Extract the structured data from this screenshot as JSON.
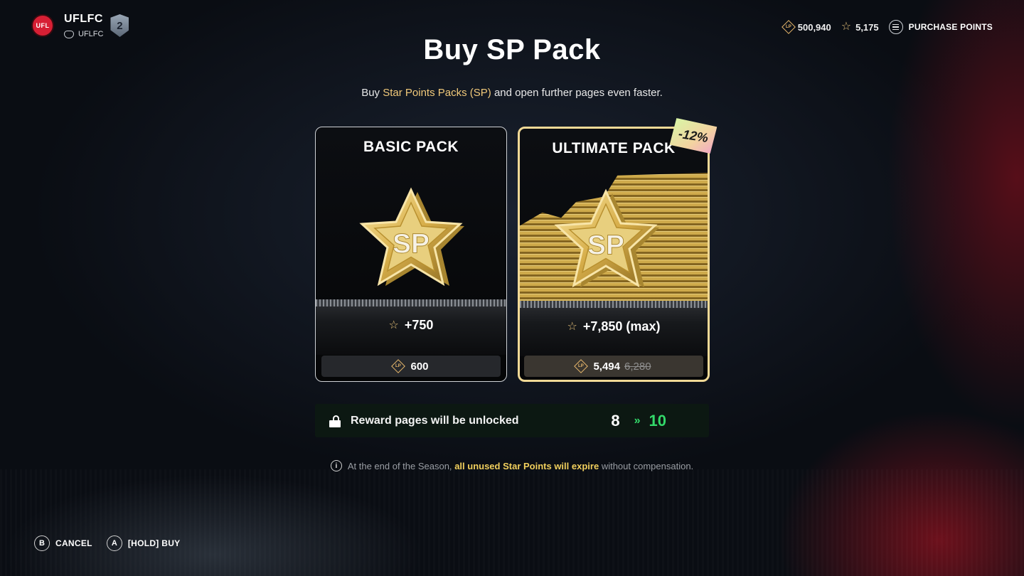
{
  "profile": {
    "logo_text": "UFL",
    "club_name": "UFLFC",
    "sub_name": "UFLFC",
    "level": "2"
  },
  "header": {
    "ufl_points": "500,940",
    "star_points": "5,175",
    "purchase_label": "PURCHASE POINTS",
    "ufl_icon_text": "LP",
    "sp_icon_text": "SP"
  },
  "page": {
    "title": "Buy SP Pack",
    "subtitle_pre": "Buy ",
    "subtitle_highlight": "Star Points Packs (SP)",
    "subtitle_post": " and open further pages even faster."
  },
  "packs": [
    {
      "title": "BASIC PACK",
      "reward": "+750",
      "price": "600",
      "old_price": "",
      "selected": false
    },
    {
      "title": "ULTIMATE PACK",
      "reward": "+7,850 (max)",
      "price": "5,494",
      "old_price": "6,280",
      "discount": "-12%",
      "selected": true
    }
  ],
  "reward_pages": {
    "label": "Reward pages will be unlocked",
    "from": "8",
    "arrow": "»",
    "to": "10"
  },
  "info": {
    "pre": "At the end of the Season, ",
    "highlight": "all unused Star Points will expire",
    "post": " without compensation."
  },
  "controls": [
    {
      "key": "B",
      "label": "CANCEL"
    },
    {
      "key": "A",
      "label": "[HOLD] BUY"
    }
  ],
  "colors": {
    "gold": "#f1c97a",
    "green": "#33d96a",
    "selected_border": "#f1d996"
  },
  "icons": [
    "controller-icon",
    "ufl-points-icon",
    "star-points-icon",
    "menu-icon",
    "lock-open-icon",
    "info-icon"
  ]
}
